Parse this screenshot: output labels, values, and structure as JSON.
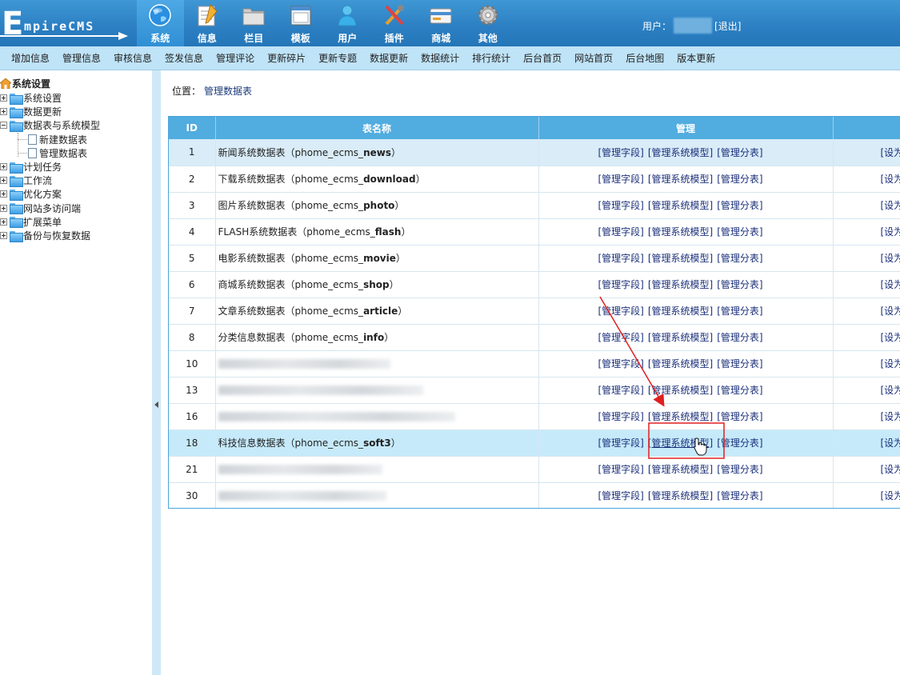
{
  "logo": {
    "initial": "E",
    "text": "mpireCMS"
  },
  "main_nav": [
    {
      "label": "系统",
      "icon": "globe-icon",
      "active": true
    },
    {
      "label": "信息",
      "icon": "notepad-icon"
    },
    {
      "label": "栏目",
      "icon": "folder-icon"
    },
    {
      "label": "模板",
      "icon": "window-icon"
    },
    {
      "label": "用户",
      "icon": "user-icon"
    },
    {
      "label": "插件",
      "icon": "tools-icon"
    },
    {
      "label": "商城",
      "icon": "card-icon"
    },
    {
      "label": "其他",
      "icon": "gear-icon"
    }
  ],
  "user": {
    "label": "用户：",
    "logout": "[退出]"
  },
  "sub_nav": [
    "增加信息",
    "管理信息",
    "审核信息",
    "签发信息",
    "管理评论",
    "更新碎片",
    "更新专题",
    "数据更新",
    "数据统计",
    "排行统计",
    "后台首页",
    "网站首页",
    "后台地图",
    "版本更新"
  ],
  "sidebar": {
    "root": "系统设置",
    "items": [
      {
        "label": "系统设置",
        "type": "folder",
        "expanded": false
      },
      {
        "label": "数据更新",
        "type": "folder",
        "expanded": false
      },
      {
        "label": "数据表与系统模型",
        "type": "folder",
        "expanded": true
      },
      {
        "label": "新建数据表",
        "type": "doc",
        "child": true
      },
      {
        "label": "管理数据表",
        "type": "doc",
        "child": true
      },
      {
        "label": "计划任务",
        "type": "folder",
        "expanded": false
      },
      {
        "label": "工作流",
        "type": "folder",
        "expanded": false
      },
      {
        "label": "优化方案",
        "type": "folder",
        "expanded": false
      },
      {
        "label": "网站多访问端",
        "type": "folder",
        "expanded": false
      },
      {
        "label": "扩展菜单",
        "type": "folder",
        "expanded": false
      },
      {
        "label": "备份与恢复数据",
        "type": "folder",
        "expanded": false
      }
    ]
  },
  "breadcrumb": {
    "prefix": "位置：",
    "link": "管理数据表"
  },
  "table": {
    "headers": [
      "ID",
      "表名称",
      "管理",
      ""
    ],
    "links": [
      "[管理字段]",
      "[管理系统模型]",
      "[管理分表]"
    ],
    "set_text": "[设为",
    "rows": [
      {
        "id": "1",
        "name": "新闻系统数据表（phome_ecms_",
        "table": "news",
        "suffix": "）"
      },
      {
        "id": "2",
        "name": "下载系统数据表（phome_ecms_",
        "table": "download",
        "suffix": "）"
      },
      {
        "id": "3",
        "name": "图片系统数据表（phome_ecms_",
        "table": "photo",
        "suffix": "）"
      },
      {
        "id": "4",
        "name": "FLASH系统数据表（phome_ecms_",
        "table": "flash",
        "suffix": "）"
      },
      {
        "id": "5",
        "name": "电影系统数据表（phome_ecms_",
        "table": "movie",
        "suffix": "）"
      },
      {
        "id": "6",
        "name": "商城系统数据表（phome_ecms_",
        "table": "shop",
        "suffix": "）"
      },
      {
        "id": "7",
        "name": "文章系统数据表（phome_ecms_",
        "table": "article",
        "suffix": "）"
      },
      {
        "id": "8",
        "name": "分类信息数据表（phome_ecms_",
        "table": "info",
        "suffix": "）"
      },
      {
        "id": "10",
        "name": "",
        "table": "",
        "suffix": "",
        "blurred": true
      },
      {
        "id": "13",
        "name": "",
        "table": "",
        "suffix": "",
        "blurred": true
      },
      {
        "id": "16",
        "name": "",
        "table": "",
        "suffix": "",
        "blurred": true
      },
      {
        "id": "18",
        "name": "科技信息数据表（phome_ecms_",
        "table": "soft3",
        "suffix": "）"
      },
      {
        "id": "21",
        "name": "",
        "table": "",
        "suffix": "",
        "blurred": true
      },
      {
        "id": "30",
        "name": "",
        "table": "",
        "suffix": "",
        "blurred": true
      }
    ]
  },
  "colors": {
    "header_blue": "#2b7fc2",
    "subnav_bg": "#bfe3f7",
    "table_header": "#51acdf",
    "annotation_red": "#e02020",
    "link": "#1a2f7a"
  }
}
